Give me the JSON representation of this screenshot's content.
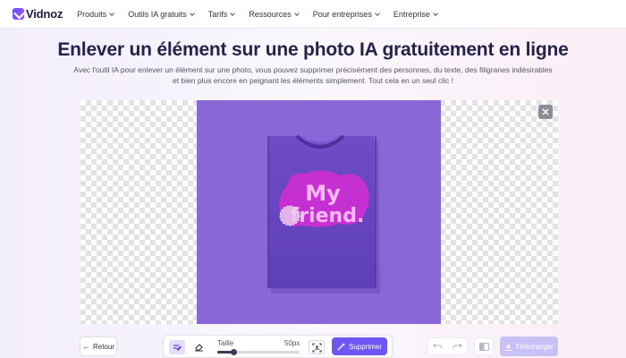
{
  "brand": {
    "name": "Vidnoz",
    "accent": "#6e56f5"
  },
  "nav": {
    "items": [
      {
        "label": "Produits"
      },
      {
        "label": "Outils IA gratuits"
      },
      {
        "label": "Tarifs"
      },
      {
        "label": "Ressources"
      },
      {
        "label": "Pour entreprises"
      },
      {
        "label": "Entreprise"
      }
    ]
  },
  "hero": {
    "title": "Enlever un élément sur une photo IA gratuitement en ligne",
    "subtitle": "Avec l'outil IA pour enlever un élément sur une photo, vous pouvez supprimer précisément des personnes, du texte, des filigranes indésirables et bien plus encore en peignant les éléments simplement. Tout cela en un seul clic !"
  },
  "editor": {
    "image_text": "My friend.",
    "photo_bg": "#8a67d6",
    "shirt_color": "#6a47c2",
    "print_color": "#c93bd4"
  },
  "toolbar": {
    "back_label": "Retour",
    "size_label": "Taille",
    "size_value": "50px",
    "size_level": 0.2,
    "delete_label": "Supprimer",
    "download_label": "Télécharger"
  },
  "icons": {
    "brush": "brush-icon",
    "eraser": "eraser-icon",
    "select": "select-object-icon",
    "undo": "undo-icon",
    "redo": "redo-icon",
    "compare": "compare-icon",
    "download": "download-icon",
    "close": "close-icon"
  }
}
